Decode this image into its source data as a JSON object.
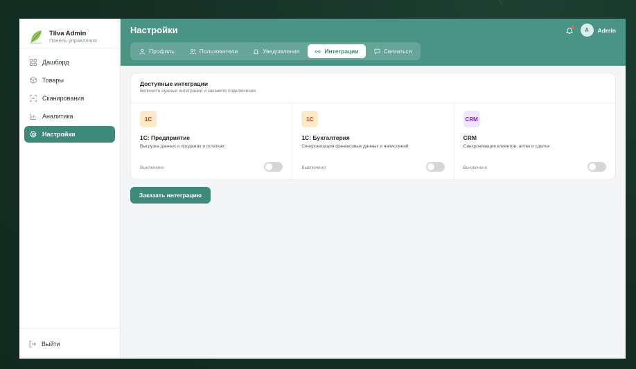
{
  "brand": {
    "title": "Tilva Admin",
    "subtitle": "Панель управления",
    "logo_icon": "leaf-logo"
  },
  "sidebar": {
    "items": [
      {
        "label": "Дашборд",
        "icon": "grid-icon",
        "active": false
      },
      {
        "label": "Товары",
        "icon": "box-icon",
        "active": false
      },
      {
        "label": "Сканирования",
        "icon": "scan-icon",
        "active": false
      },
      {
        "label": "Аналитика",
        "icon": "chart-icon",
        "active": false
      },
      {
        "label": "Настройки",
        "icon": "gear-icon",
        "active": true
      }
    ],
    "logout_label": "Выйти"
  },
  "header": {
    "title": "Настройки",
    "user_initial": "A",
    "user_name": "Admin",
    "has_notification": true
  },
  "tabs": [
    {
      "label": "Профиль",
      "icon": "user-icon",
      "active": false
    },
    {
      "label": "Пользователи",
      "icon": "users-icon",
      "active": false
    },
    {
      "label": "Уведомления",
      "icon": "bell-icon",
      "active": false
    },
    {
      "label": "Интеграции",
      "icon": "link-icon",
      "active": true
    },
    {
      "label": "Связаться",
      "icon": "chat-icon",
      "active": false
    }
  ],
  "integrations_card": {
    "title": "Доступные интеграции",
    "subtitle": "Включите нужные интеграции и закажите подключение",
    "items": [
      {
        "badge": "1С",
        "name": "1С: Предприятие",
        "description": "Выгрузка данных о продажах и остатках",
        "status": "Выключено",
        "enabled": false,
        "badge_bg": "#fde8c8",
        "badge_color": "#c2410c"
      },
      {
        "badge": "1С",
        "name": "1С: Бухгалтерия",
        "description": "Синхронизация финансовых данных и начислений",
        "status": "Выключено",
        "enabled": false,
        "badge_bg": "#fde8c8",
        "badge_color": "#c2410c"
      },
      {
        "badge": "CRM",
        "name": "CRM",
        "description": "Синхронизация клиентов, аптек и сделок",
        "status": "Выключено",
        "enabled": false,
        "badge_bg": "#f1e4fd",
        "badge_color": "#7e22ce"
      }
    ]
  },
  "order_button": {
    "label": "Заказать интеграцию"
  },
  "colors": {
    "accent": "#3d8a7b",
    "header_bg": "#4a9485",
    "page_bg": "#173328"
  }
}
